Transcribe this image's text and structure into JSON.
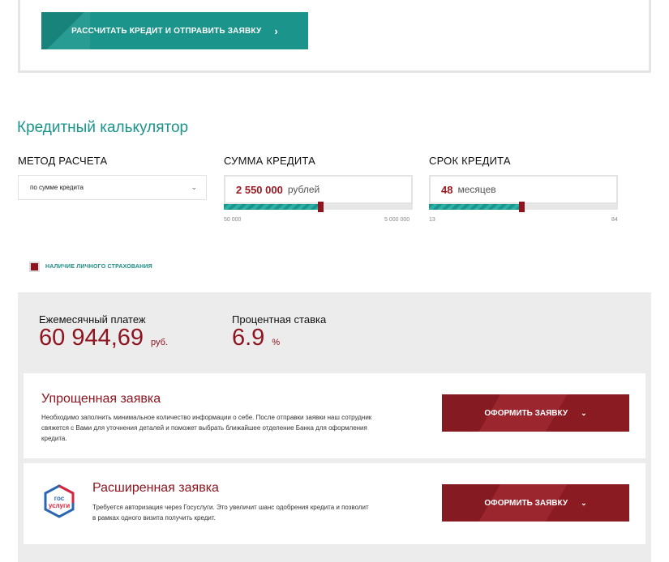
{
  "top_button": {
    "label": "РАССЧИТАТЬ КРЕДИТ И ОТПРАВИТЬ ЗАЯВКУ",
    "icon": "chevron-right-icon"
  },
  "calculator": {
    "title": "Кредитный калькулятор",
    "method": {
      "label": "МЕТОД РАСЧЕТА",
      "selected": "по сумме кредита"
    },
    "amount": {
      "label": "СУММА КРЕДИТА",
      "value": "2 550 000",
      "unit": "рублей",
      "min": "50 000",
      "max": "5 000 000",
      "fraction": 0.51
    },
    "term": {
      "label": "СРОК КРЕДИТА",
      "value": "48",
      "unit": "месяцев",
      "min": "13",
      "max": "84",
      "fraction": 0.49
    },
    "insurance_label": "НАЛИЧИЕ ЛИЧНОГО СТРАХОВАНИЯ"
  },
  "results": {
    "payment_label": "Ежемесячный платеж",
    "payment_value": "60 944,69",
    "payment_unit": "руб.",
    "rate_label": "Процентная ставка",
    "rate_value": "6.9",
    "rate_unit": "%"
  },
  "simple_application": {
    "title": "Упрощенная заявка",
    "description": "Необходимо заполнить минимальное количество информации о себе. После отправки заявки наш сотрудник свяжется с Вами для уточнения деталей и поможет выбрать ближайшее отделение Банка для оформления кредита.",
    "button": "ОФОРМИТЬ ЗАЯВКУ"
  },
  "extended_application": {
    "title": "Расширенная заявка",
    "description": "Требуется авторизация через Госуслуги. Это увеличит шанс одобрения кредита и позволит в рамках одного визита получить кредит.",
    "button": "ОФОРМИТЬ ЗАЯВКУ",
    "logo_text_1": "гос",
    "logo_text_2": "услуги"
  },
  "colors": {
    "teal": "#1b958c",
    "maroon": "#8e1520",
    "panel": "#ececec"
  }
}
